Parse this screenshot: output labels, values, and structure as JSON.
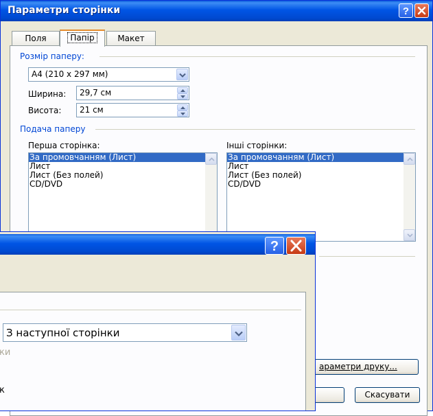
{
  "dialog": {
    "title": "Параметри сторінки",
    "tabs": [
      {
        "label": "Поля",
        "active": false
      },
      {
        "label": "Папір",
        "active": true
      },
      {
        "label": "Макет",
        "active": false
      }
    ],
    "paper_size": {
      "group_label": "Розмір паперу:",
      "selected": "A4 (210 x 297 мм)",
      "width_label": "Ширина:",
      "width_value": "29,7 см",
      "height_label": "Висота:",
      "height_value": "21 см"
    },
    "paper_source": {
      "group_label": "Подача паперу",
      "first_page_label": "Перша сторінка:",
      "other_pages_label": "Інші сторінки:",
      "first_page_items": [
        "За промовчанням (Лист)",
        "Лист",
        "Лист (Без полей)",
        "CD/DVD"
      ],
      "other_pages_items": [
        "За промовчанням (Лист)",
        "Лист",
        "Лист (Без полей)",
        "CD/DVD"
      ],
      "selected_index": 0
    },
    "print_options_button": "араметри друку...",
    "cancel_button": "Скасувати"
  },
  "front_dialog": {
    "apply_selected": "З наступної сторінки",
    "partial_text_1": "ки",
    "partial_text_2": "к"
  },
  "colors": {
    "title_blue": "#0055e5",
    "group_blue": "#0046d5",
    "selection": "#316ac5",
    "close_red": "#c63a14",
    "dialog_bg": "#ece9d8"
  }
}
